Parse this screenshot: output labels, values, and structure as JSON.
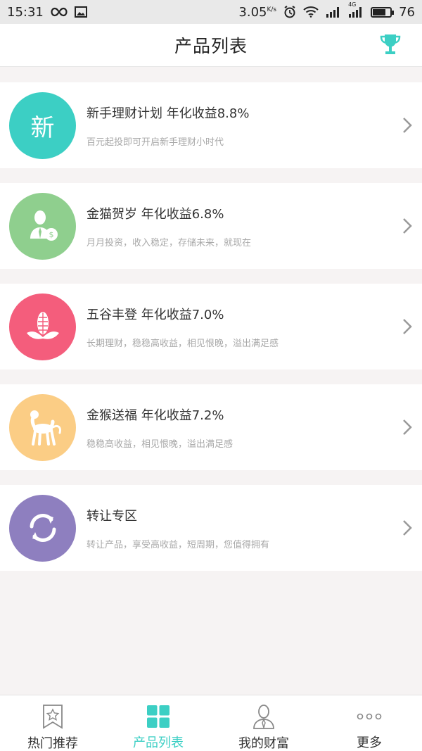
{
  "status_bar": {
    "time": "15:31",
    "speed": "3.05",
    "speed_unit": "K/s",
    "network": "4G",
    "battery": "76",
    "battery_level": 0.76
  },
  "header": {
    "title": "产品列表"
  },
  "products": [
    {
      "title": "新手理财计划 年化收益8.8%",
      "desc": "百元起投即可开启新手理财小时代",
      "icon_text": "新",
      "icon": "new-icon",
      "color": "#3ccfc4"
    },
    {
      "title": "金猫贺岁 年化收益6.8%",
      "desc": "月月投资，收入稳定，存储未来，就现在",
      "icon": "investor-icon",
      "color": "#8fcf8e"
    },
    {
      "title": "五谷丰登 年化收益7.0%",
      "desc": "长期理财，稳稳高收益，相见恨晚，溢出满足感",
      "icon": "corn-icon",
      "color": "#f45d7c"
    },
    {
      "title": "金猴送福  年化收益7.2%",
      "desc": "稳稳高收益，相见恨晚，溢出满足感",
      "icon": "monkey-icon",
      "color": "#fbcd85"
    },
    {
      "title": "转让专区",
      "desc": "转让产品，享受高收益，短周期，您值得拥有",
      "icon": "transfer-icon",
      "color": "#8e7fbf"
    }
  ],
  "tabs": [
    {
      "label": "热门推荐",
      "icon": "bookmark-star-icon",
      "active": false
    },
    {
      "label": "产品列表",
      "icon": "grid-icon",
      "active": true
    },
    {
      "label": "我的财富",
      "icon": "user-icon",
      "active": false
    },
    {
      "label": "更多",
      "icon": "more-icon",
      "active": false
    }
  ],
  "colors": {
    "accent": "#3ccfc4",
    "background": "#f6f3f3"
  }
}
